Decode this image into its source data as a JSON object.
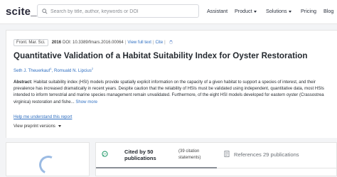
{
  "header": {
    "logo": "scite_",
    "search_placeholder": "Search by title, author, keywords or DOI",
    "nav": [
      {
        "label": "Assistant"
      },
      {
        "label": "Product"
      },
      {
        "label": "Solutions"
      },
      {
        "label": "Pricing"
      },
      {
        "label": "Blog"
      }
    ]
  },
  "article": {
    "journal": "Front. Mar. Sci.",
    "year": "2016",
    "doi": "DOI: 10.3389/fmars.2016.00064",
    "sep1": "|",
    "view_full_text": "View full text",
    "sep2": "|",
    "cite": "Cite",
    "sep3": "|",
    "title": "Quantitative Validation of a Habitat Suitability Index for Oyster Restoration",
    "authors": [
      {
        "name": "Seth J. Theuerkauf",
        "sup": "1"
      },
      {
        "name": "Romuald N. Lipcius",
        "sup": "2"
      }
    ],
    "abstract_label": "Abstract:",
    "abstract_text": " Habitat suitability index (HSI) models provide spatially explicit information on the capacity of a given habitat to support a species of interest, and their prevalence has increased dramatically in recent years. Despite caution that the reliability of HSIs must be validated using independent, quantitative data, most HSIs intended to inform terrestrial and marine species management remain unvalidated. Furthermore, of the eight HSI models developed for eastern oyster (Crassostrea virginica) restoration and fishe... ",
    "show_more": "Show more",
    "help_link": "Help me understand this report",
    "preprint_toggle": "View preprint versions"
  },
  "tabs": {
    "cited_by": "Cited by 50 publications",
    "citation_statements": "(39 citation statements)",
    "references": "References 29 publications"
  },
  "colors": {
    "link": "#2f6fc1",
    "cite_icon": "#2a9d6f",
    "background": "#f3f4f6"
  }
}
